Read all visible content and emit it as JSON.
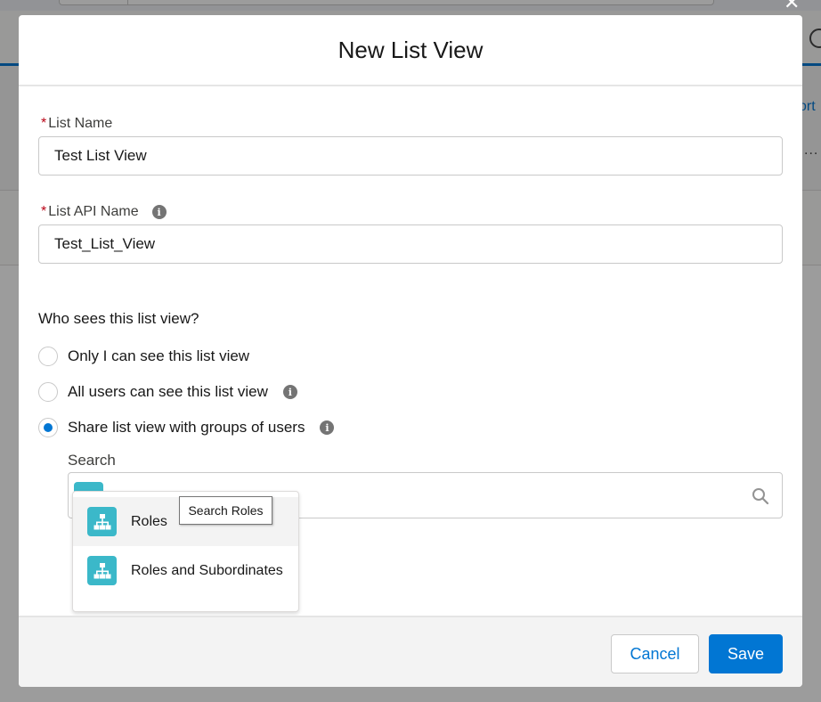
{
  "background": {
    "partial_link": "ort",
    "partial_dots": "..."
  },
  "modal": {
    "title": "New List View",
    "list_name": {
      "label": "List Name",
      "required_marker": "*",
      "value": "Test List View"
    },
    "list_api_name": {
      "label": "List API Name",
      "required_marker": "*",
      "value": "Test_List_View",
      "info_icon": "info-icon"
    },
    "visibility": {
      "title": "Who sees this list view?",
      "options": [
        {
          "label": "Only I can see this list view",
          "checked": false
        },
        {
          "label": "All users can see this list view",
          "checked": false,
          "info_icon": "info-icon"
        },
        {
          "label": "Share list view with groups of users",
          "checked": true,
          "info_icon": "info-icon"
        }
      ]
    },
    "search": {
      "label": "Search",
      "tooltip": "Search Roles",
      "icon": "search-icon",
      "dropdown": [
        {
          "label": "Roles",
          "icon": "hierarchy-icon"
        },
        {
          "label": "Roles and Subordinates",
          "icon": "hierarchy-icon"
        }
      ]
    },
    "footer": {
      "cancel_label": "Cancel",
      "save_label": "Save"
    }
  },
  "colors": {
    "brand": "#0176d3",
    "required": "#ba0517",
    "role_icon": "#3bb8c9",
    "info_icon": "#747474"
  }
}
